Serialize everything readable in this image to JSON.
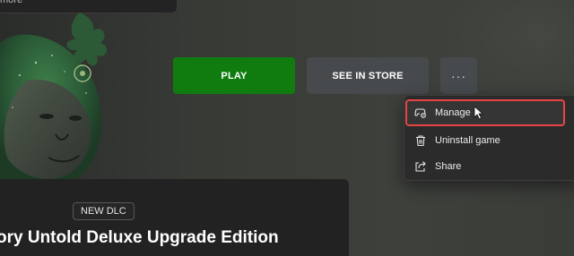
{
  "top_card": {
    "text": "more"
  },
  "actions": {
    "play_label": "PLAY",
    "store_label": "SEE IN STORE",
    "more_label": "···"
  },
  "menu": {
    "items": [
      {
        "label": "Manage",
        "icon": "gamepad-settings-icon",
        "highlighted": true
      },
      {
        "label": "Uninstall game",
        "icon": "trash-icon"
      },
      {
        "label": "Share",
        "icon": "share-icon"
      }
    ]
  },
  "info": {
    "badge": "NEW DLC",
    "title": "ory Untold Deluxe Upgrade Edition"
  },
  "colors": {
    "play": "#107c10",
    "secondary_button": "#474a4d",
    "menu_bg": "#2b2b2b",
    "highlight_border": "#e64545"
  }
}
